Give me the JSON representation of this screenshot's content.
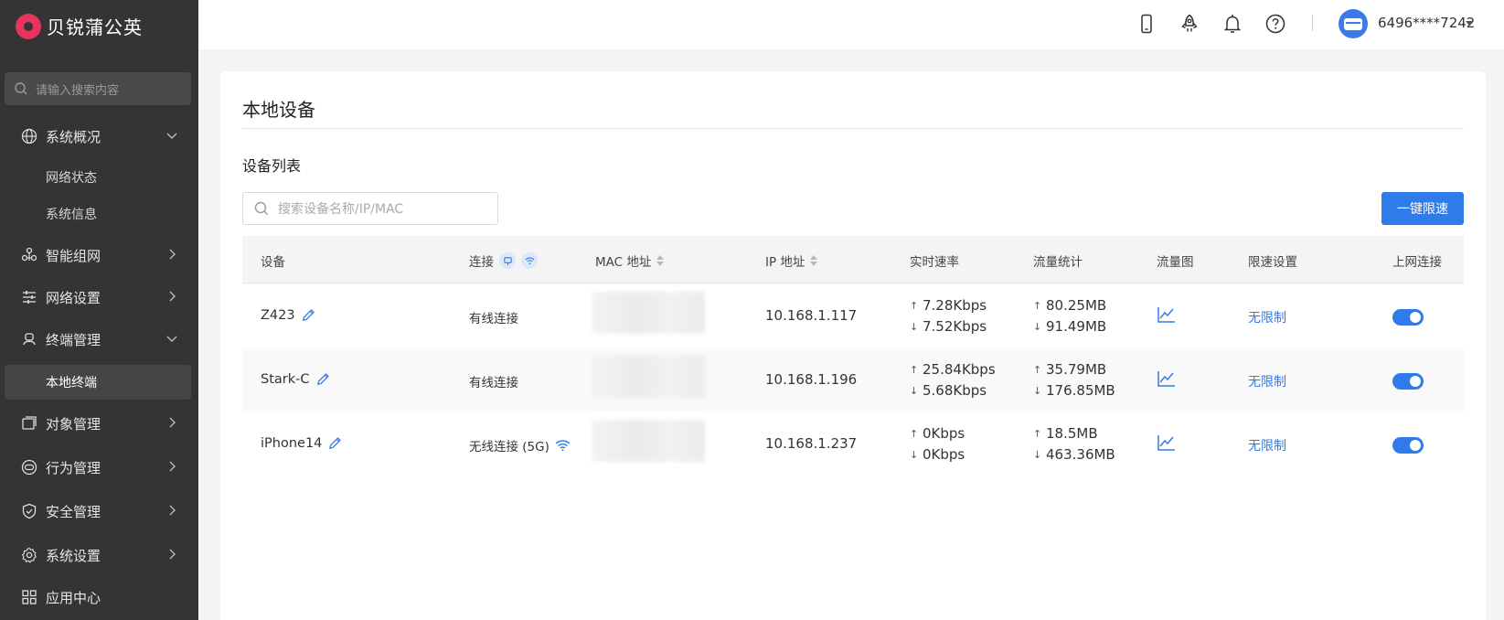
{
  "brand": {
    "name": "贝锐蒲公英"
  },
  "sidebar": {
    "search_placeholder": "请输入搜索内容",
    "items": [
      {
        "label": "系统概况",
        "icon": "globe-icon",
        "expanded": true
      },
      {
        "label": "网络状态",
        "sub": true
      },
      {
        "label": "系统信息",
        "sub": true
      },
      {
        "label": "智能组网",
        "icon": "network-icon",
        "expanded": false
      },
      {
        "label": "网络设置",
        "icon": "sliders-icon",
        "expanded": false
      },
      {
        "label": "终端管理",
        "icon": "terminal-icon",
        "expanded": true
      },
      {
        "label": "本地终端",
        "sub": true,
        "active": true
      },
      {
        "label": "对象管理",
        "icon": "object-icon",
        "expanded": false
      },
      {
        "label": "行为管理",
        "icon": "behavior-icon",
        "expanded": false
      },
      {
        "label": "安全管理",
        "icon": "shield-icon",
        "expanded": false
      },
      {
        "label": "系统设置",
        "icon": "gear-icon",
        "expanded": false
      },
      {
        "label": "应用中心",
        "icon": "apps-icon"
      }
    ]
  },
  "topbar": {
    "icons": [
      "phone-icon",
      "rocket-icon",
      "bell-icon",
      "help-icon"
    ],
    "username": "6496****7242"
  },
  "page": {
    "title": "本地设备",
    "section_title": "设备列表",
    "search_placeholder": "搜索设备名称/IP/MAC",
    "limit_button": "一键限速"
  },
  "table": {
    "columns": {
      "device": "设备",
      "connection": "连接",
      "mac": "MAC 地址",
      "ip": "IP 地址",
      "rate": "实时速率",
      "traffic": "流量统计",
      "chart": "流量图",
      "limit": "限速设置",
      "online": "上网连接"
    },
    "rows": [
      {
        "name": "Z423",
        "connection": "有线连接",
        "ip": "10.168.1.117",
        "up": "7.28Kbps",
        "down": "7.52Kbps",
        "t_up": "80.25MB",
        "t_down": "91.49MB",
        "limit": "无限制",
        "online": true
      },
      {
        "name": "Stark-C",
        "connection": "有线连接",
        "ip": "10.168.1.196",
        "up": "25.84Kbps",
        "down": "5.68Kbps",
        "t_up": "35.79MB",
        "t_down": "176.85MB",
        "limit": "无限制",
        "online": true
      },
      {
        "name": "iPhone14",
        "connection": "无线连接 (5G)",
        "ip": "10.168.1.237",
        "up": "0Kbps",
        "down": "0Kbps",
        "t_up": "18.5MB",
        "t_down": "463.36MB",
        "limit": "无限制",
        "online": true
      }
    ]
  },
  "colors": {
    "accent": "#2f7bea",
    "sidebar_bg": "#343434",
    "brand_red": "#e8335e"
  }
}
